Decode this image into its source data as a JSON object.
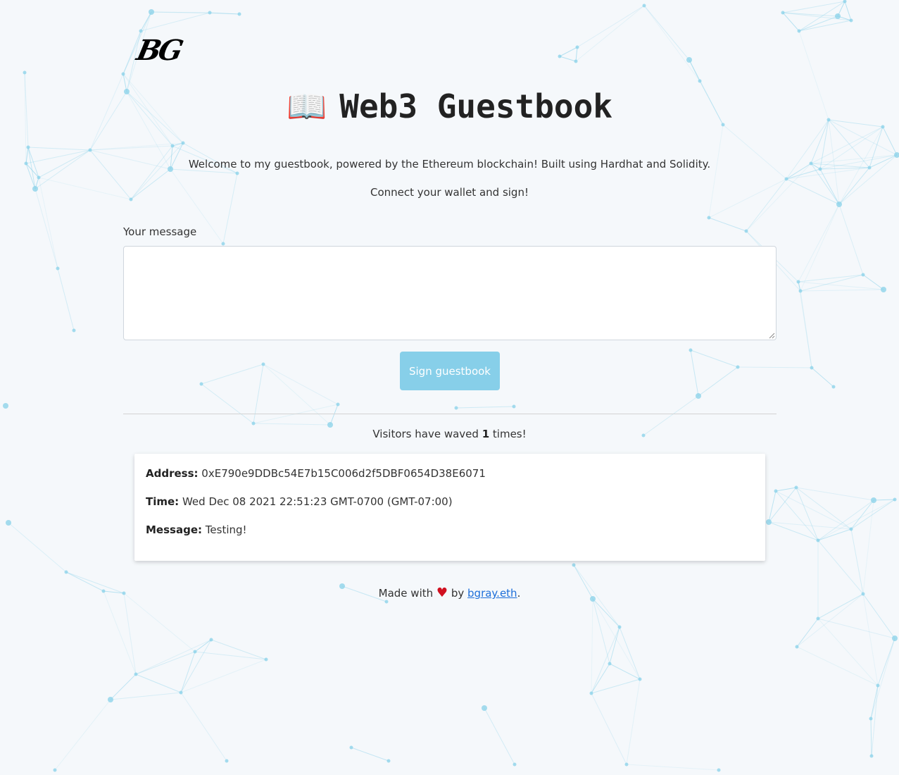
{
  "logo": "BG",
  "header": {
    "icon": "open-book-icon",
    "icon_glyph": "📖",
    "title": "Web3 Guestbook"
  },
  "intro": {
    "line1": "Welcome to my guestbook, powered by the Ethereum blockchain! Built using Hardhat and Solidity.",
    "line2": "Connect your wallet and sign!"
  },
  "form": {
    "label": "Your message",
    "value": "",
    "button_label": "Sign guestbook"
  },
  "stats": {
    "prefix": "Visitors have waved",
    "count": "1",
    "suffix": "times!"
  },
  "entries": [
    {
      "address_label": "Address:",
      "address": "0xE790e9DDBc54E7b15C006d2f5DBF0654D38E6071",
      "time_label": "Time:",
      "time": "Wed Dec 08 2021 22:51:23 GMT-0700 (GMT-07:00)",
      "message_label": "Message:",
      "message": "Testing!"
    }
  ],
  "footer": {
    "prefix": "Made with",
    "heart_icon": "heart-icon",
    "heart_glyph": "♥",
    "by": "by",
    "link_text": "bgray.eth",
    "suffix": "."
  },
  "colors": {
    "background": "#f5f8fb",
    "network_lines": "#8fd3ea",
    "button": "#87cfe9",
    "link": "#1e6fd9",
    "heart": "#d01020"
  }
}
